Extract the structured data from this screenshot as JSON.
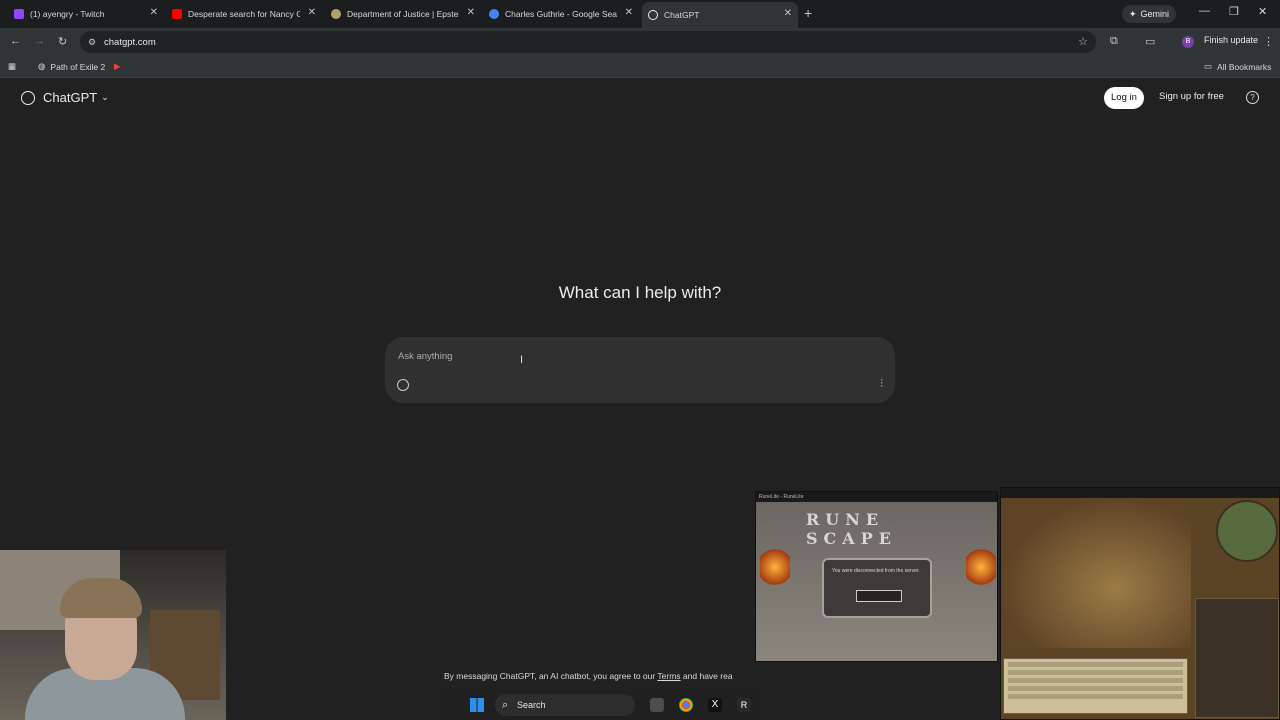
{
  "browser": {
    "tabs": [
      {
        "title": "(1) ayengry - Twitch",
        "favicon_color": "#9146ff"
      },
      {
        "title": "Desperate search for Nancy Gu",
        "favicon_color": "#ff0000"
      },
      {
        "title": "Department of Justice | Epstein",
        "favicon_color": "#b5a16a"
      },
      {
        "title": "Charles Guthrie - Google Searc",
        "favicon_color": "#4285f4"
      },
      {
        "title": "ChatGPT",
        "favicon_color": "#ececec"
      }
    ],
    "gemini_label": "Gemini",
    "url": "chatgpt.com",
    "finish_update_label": "Finish update",
    "profile_initial": "B",
    "bookmarks": [
      {
        "label": "Path of Exile 2"
      }
    ],
    "all_bookmarks_label": "All Bookmarks"
  },
  "chatgpt": {
    "brand": "ChatGPT",
    "login_label": "Log in",
    "signup_label": "Sign up for free",
    "headline": "What can I help with?",
    "composer_placeholder": "Ask anything",
    "disclaimer_prefix": "By messaging ChatGPT, an AI chatbot, you agree to our ",
    "disclaimer_terms": "Terms",
    "disclaimer_suffix": " and have rea"
  },
  "overlays": {
    "game1_title": "RuneLite - RuneLite",
    "game1_logo": "RUNE SCAPE",
    "game1_dialog": "You were disconnected from the server.",
    "taskbar_search": "Search"
  }
}
